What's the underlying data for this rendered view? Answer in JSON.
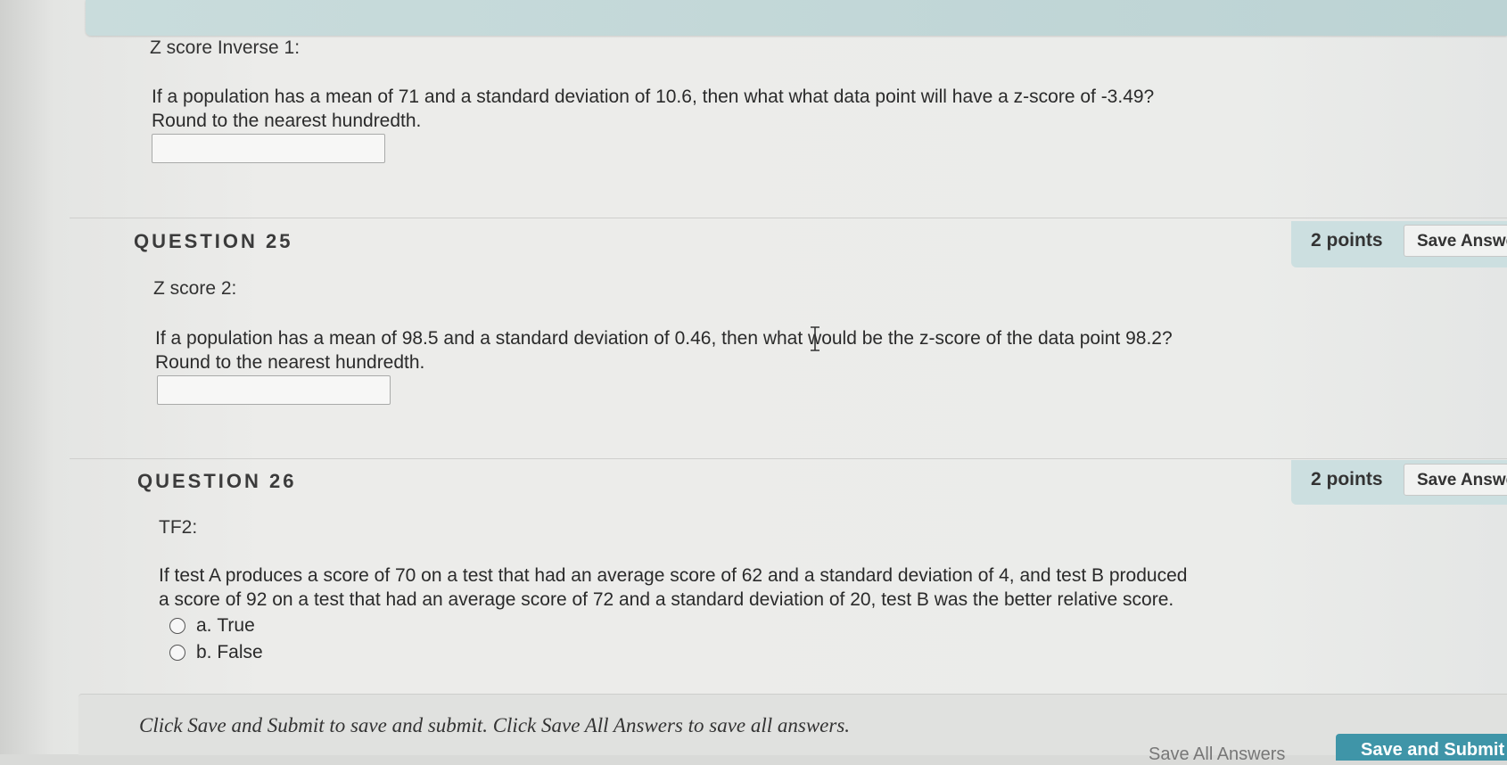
{
  "previous_question": {
    "title": "Z score Inverse 1:",
    "text_line1": "If a population has a mean of 71 and a standard deviation of 10.6, then what what data point will have a z-score of -3.49?",
    "text_line2": "Round to the nearest hundredth.",
    "answer_value": ""
  },
  "questions": [
    {
      "label": "QUESTION 25",
      "points": "2 points",
      "save_label": "Save Answer",
      "title": "Z score 2:",
      "text_line1": "If a population has a mean of 98.5 and a standard deviation of 0.46, then what would be the z-score of the data point 98.2?",
      "text_line2": "Round to the nearest hundredth.",
      "answer_value": ""
    },
    {
      "label": "QUESTION 26",
      "points": "2 points",
      "save_label": "Save Answer",
      "title": "TF2:",
      "text_line1": "If test A produces a score of 70 on a test that had an average score of 62 and a standard deviation of 4, and test B produced",
      "text_line2": "a score of 92 on a test that had an average score of 72 and a standard deviation of 20, test B was the better relative score.",
      "options": [
        {
          "letter": "a.",
          "label": "True"
        },
        {
          "letter": "b.",
          "label": "False"
        }
      ]
    }
  ],
  "footer": {
    "instruction": "Click Save and Submit to save and submit. Click Save All Answers to save all answers.",
    "save_all_label": "Save All Answers",
    "submit_label": "Save and Submit"
  },
  "colors": {
    "points_box": "#ccdfe0",
    "submit_button": "#3f95a8"
  }
}
